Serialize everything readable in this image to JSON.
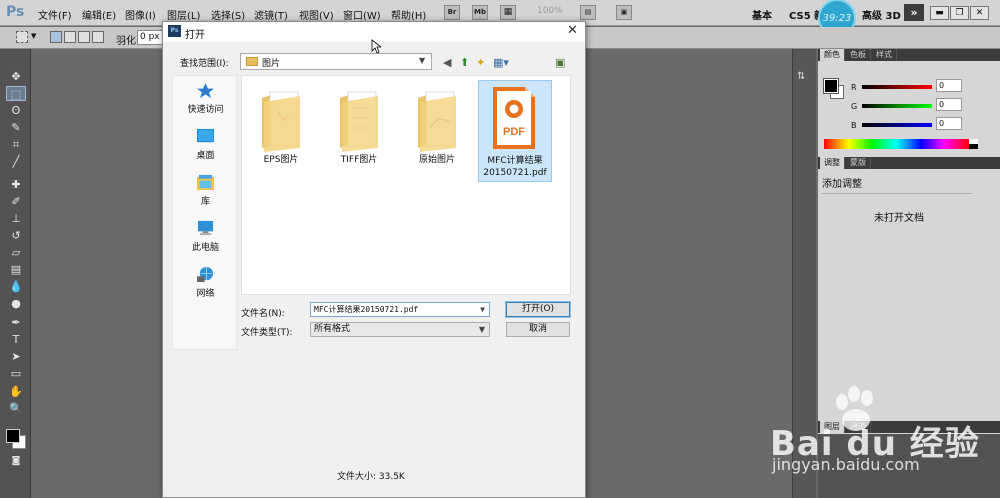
{
  "app": {
    "logo": "Ps"
  },
  "menu": [
    "文件(F)",
    "编辑(E)",
    "图像(I)",
    "图层(L)",
    "选择(S)",
    "滤镜(T)",
    "视图(V)",
    "窗口(W)",
    "帮助(H)"
  ],
  "menubar_extras": {
    "br_label": "Br",
    "mb_label": "Mb",
    "zoom": "100%"
  },
  "workspace": {
    "basic": "基本",
    "cs5_new": "CS5 新",
    "advanced_3d": "高级 3D",
    "clock": "39:23",
    "more": "»"
  },
  "options_bar": {
    "feather_label": "羽化:",
    "feather_value": "0 px"
  },
  "panels": {
    "color_tabs": [
      "颜色",
      "色板",
      "样式"
    ],
    "rgb": [
      {
        "label": "R",
        "value": "0"
      },
      {
        "label": "G",
        "value": "0"
      },
      {
        "label": "B",
        "value": "0"
      }
    ],
    "adjust_tabs": [
      "调整",
      "蒙版"
    ],
    "adjust_title": "添加调整",
    "no_document": "未打开文档",
    "layers_tabs": [
      "图层",
      "通道"
    ]
  },
  "dialog": {
    "title": "打开",
    "look_in_label": "查找范围(I):",
    "look_in_value": "图片",
    "places": [
      {
        "label": "快速访问",
        "icon": "star-icon"
      },
      {
        "label": "桌面",
        "icon": "desktop-icon"
      },
      {
        "label": "库",
        "icon": "library-icon"
      },
      {
        "label": "此电脑",
        "icon": "computer-icon"
      },
      {
        "label": "网络",
        "icon": "network-icon"
      }
    ],
    "files": [
      {
        "name": "EPS图片",
        "type": "folder"
      },
      {
        "name": "TIFF图片",
        "type": "folder"
      },
      {
        "name": "原始图片",
        "type": "folder"
      },
      {
        "name": "MFC计算结果20150721.pdf",
        "type": "pdf",
        "selected": true,
        "badge": "PDF"
      }
    ],
    "filename_label": "文件名(N):",
    "filename_value": "MFC计算结果20150721.pdf",
    "filetype_label": "文件类型(T):",
    "filetype_value": "所有格式",
    "open_button": "打开(O)",
    "cancel_button": "取消",
    "file_size": "文件大小: 33.5K"
  },
  "watermark": {
    "brand": "Bai du 经验",
    "url": "jingyan.baidu.com"
  },
  "colors": {
    "accent_selection": "#cce5fb",
    "folder": "#f3d27a",
    "pdf_orange": "#e8711c",
    "clock": "#2ea6cf"
  }
}
